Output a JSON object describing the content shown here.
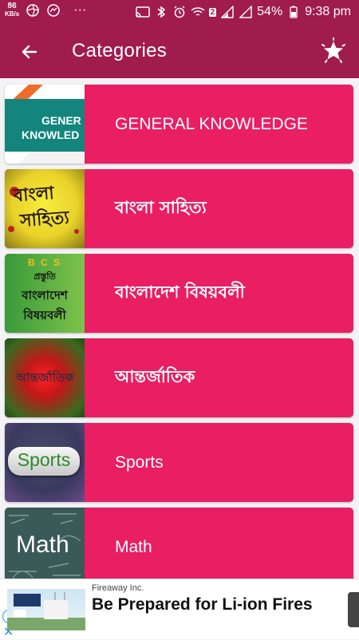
{
  "status_bar": {
    "net_speed_value": "86",
    "net_speed_unit": "KB/s",
    "more_dots": "···",
    "sim_badge": "2",
    "battery": "54%",
    "time": "9:38 pm"
  },
  "app_bar": {
    "title": "Categories"
  },
  "categories": [
    {
      "label": "GENERAL KNOWLEDGE",
      "thumb_line1": "GENER",
      "thumb_line2": "KNOWLED"
    },
    {
      "label": "বাংলা সাহিত্য",
      "thumb_line1": "বাংলা",
      "thumb_line2": "সাহিত্য"
    },
    {
      "label": "বাংলাদেশ বিষয়বলী",
      "thumb_line1": "B C S",
      "thumb_line2": "প্রস্তুতি",
      "thumb_line3": "বাংলাদেশ",
      "thumb_line4": "বিষয়বলী"
    },
    {
      "label": "আন্তর্জাতিক",
      "thumb_line1": "আন্তর্জাতিক"
    },
    {
      "label": "Sports",
      "thumb_line1": "Sports"
    },
    {
      "label": "Math",
      "thumb_line1": "Math"
    }
  ],
  "ad": {
    "sponsor": "Fireaway Inc.",
    "headline": "Be Prepared for Li-ion Fires",
    "info_icon": "i",
    "close_icon": "✕"
  },
  "colors": {
    "app_bar": "#a01c4c",
    "card": "#e91e63",
    "background": "#f3f3f5"
  }
}
